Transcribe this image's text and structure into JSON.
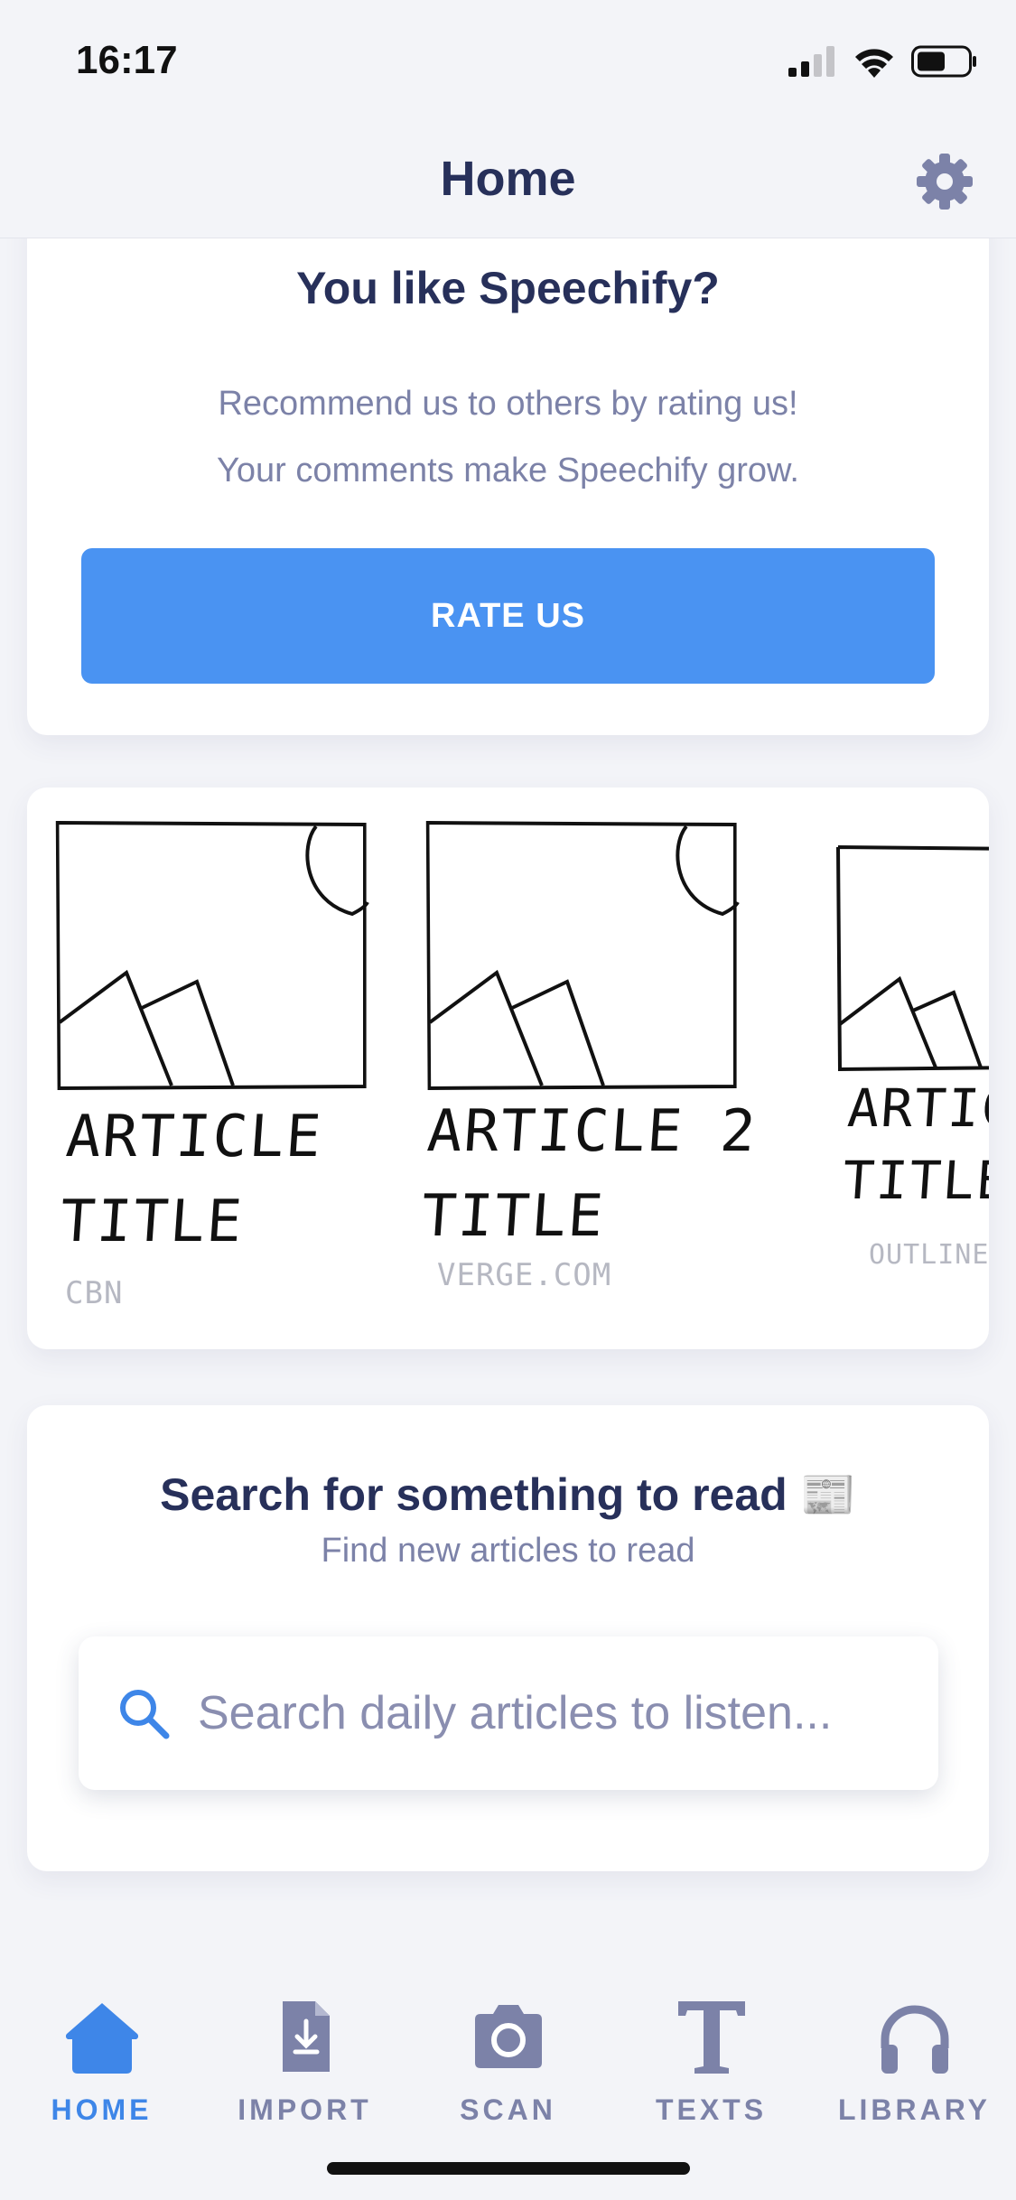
{
  "status_bar": {
    "time": "16:17"
  },
  "nav": {
    "title": "Home"
  },
  "rate_card": {
    "title": "You like Speechify?",
    "line1": "Recommend us to others by rating us!",
    "line2": "Your comments make Speechify grow.",
    "button_label": "RATE US"
  },
  "articles": [
    {
      "title": "ARTICLE\nTITLE",
      "source": "CBN"
    },
    {
      "title": "ARTICLE 2\nTITLE",
      "source": "VERGE.COM"
    },
    {
      "title": "ARTIC\nTITLE",
      "source": "OUTLINE"
    }
  ],
  "search_card": {
    "title": "Search for something to read 📰",
    "subtitle": "Find new articles to read",
    "placeholder": "Search daily articles to listen..."
  },
  "tabs": [
    {
      "label": "HOME",
      "icon": "home-icon",
      "active": true
    },
    {
      "label": "IMPORT",
      "icon": "import-icon",
      "active": false
    },
    {
      "label": "SCAN",
      "icon": "camera-icon",
      "active": false
    },
    {
      "label": "TEXTS",
      "icon": "text-icon",
      "active": false
    },
    {
      "label": "LIBRARY",
      "icon": "headphones-icon",
      "active": false
    }
  ],
  "colors": {
    "accent": "#4a93f2",
    "active_tab": "#3e86e8",
    "inactive": "#7c82a8",
    "heading": "#27305a",
    "background": "#f3f4f8"
  }
}
